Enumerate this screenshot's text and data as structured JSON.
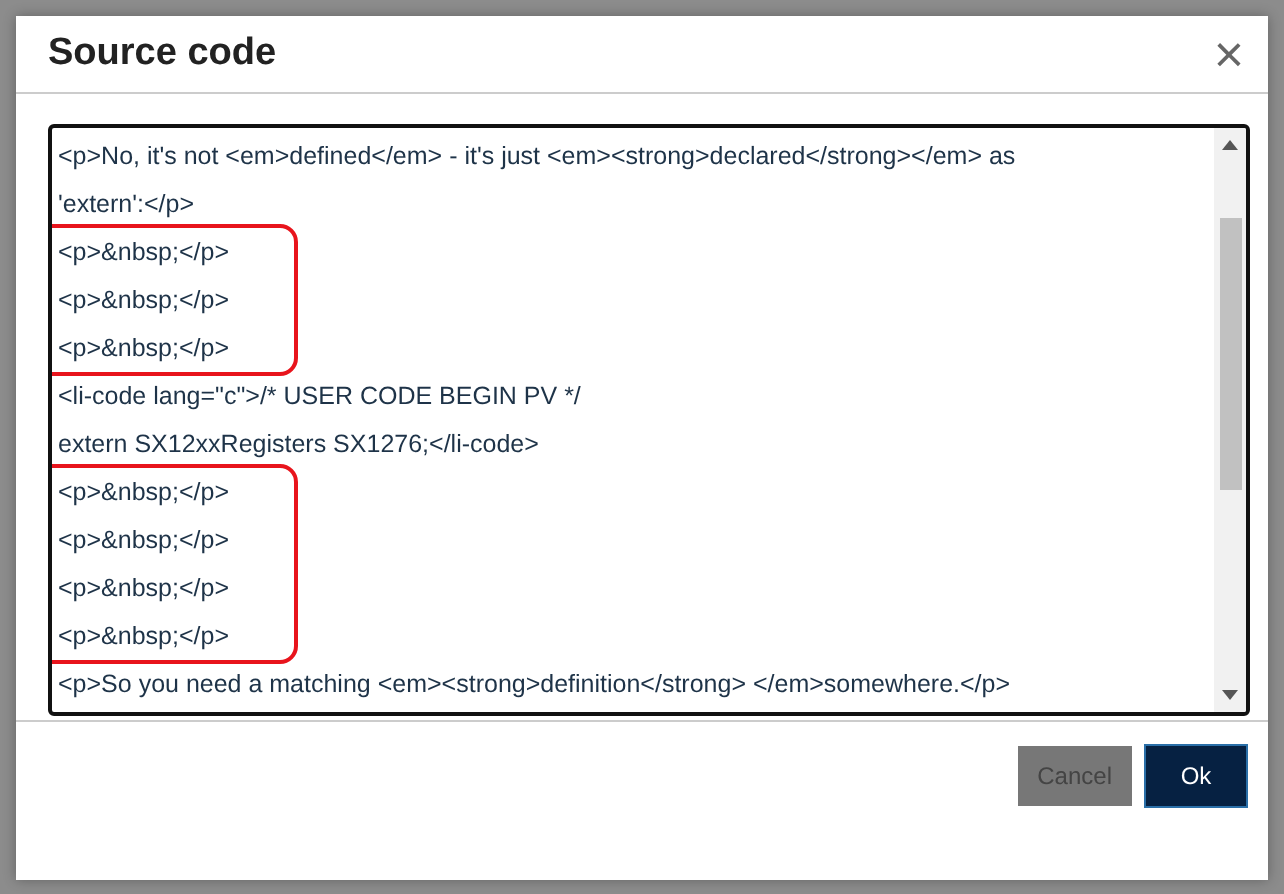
{
  "dialog": {
    "title": "Source code",
    "close_label": "×"
  },
  "source_blocks": [
    {
      "kind": "plain",
      "lines": [
        "<p>No, it's not <em>defined</em> - it's just <em><strong>declared</strong></em> as",
        "'extern':</p>"
      ]
    },
    {
      "kind": "highlight",
      "lines": [
        "<p>&nbsp;</p>",
        "<p>&nbsp;</p>",
        "<p>&nbsp;</p>"
      ]
    },
    {
      "kind": "plain",
      "lines": [
        "<li-code lang=\"c\">/* USER CODE BEGIN PV */",
        "extern SX12xxRegisters SX1276;</li-code>"
      ]
    },
    {
      "kind": "highlight",
      "lines": [
        "<p>&nbsp;</p>",
        "<p>&nbsp;</p>",
        "<p>&nbsp;</p>",
        "<p>&nbsp;</p>"
      ]
    },
    {
      "kind": "plain",
      "lines": [
        "<p>So you need a matching <em><strong>definition</strong> </em>somewhere.</p>"
      ]
    }
  ],
  "buttons": [
    {
      "label": "Cancel",
      "kind": "secondary",
      "disabled": true
    },
    {
      "label": "Ok",
      "kind": "primary",
      "disabled": false
    }
  ]
}
